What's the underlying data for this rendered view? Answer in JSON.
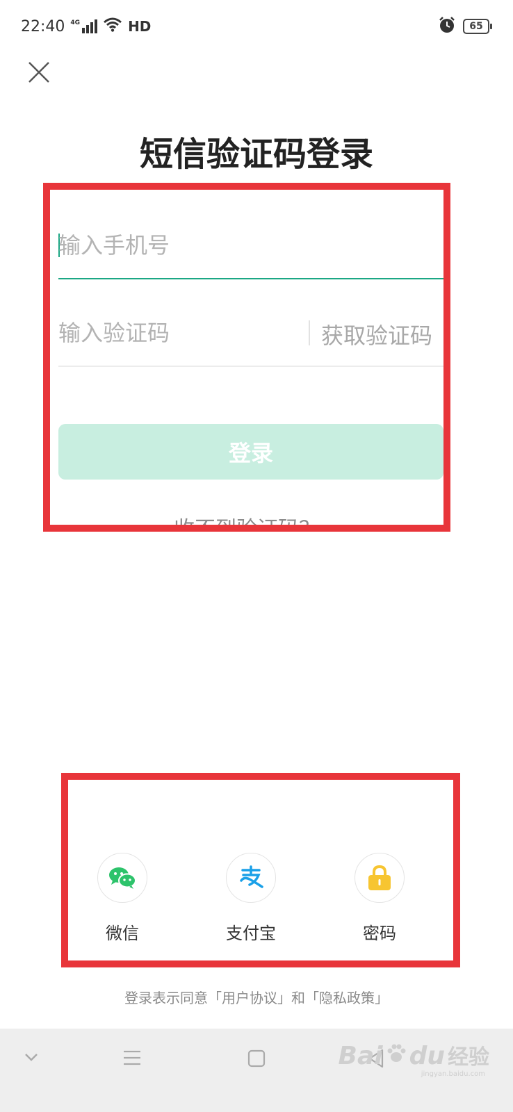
{
  "status_bar": {
    "time": "22:40",
    "network": "4G",
    "hd": "HD",
    "battery": "65",
    "icons": [
      "signal-icon",
      "wifi-icon",
      "alarm-icon",
      "battery-icon"
    ]
  },
  "page": {
    "title": "短信验证码登录",
    "close_icon": "close-icon"
  },
  "form": {
    "phone_placeholder": "输入手机号",
    "code_placeholder": "输入验证码",
    "get_code_label": "获取验证码",
    "login_label": "登录",
    "help_text": "收不到验证码？"
  },
  "third_party": {
    "items": [
      {
        "label": "微信",
        "icon": "wechat-icon"
      },
      {
        "label": "支付宝",
        "icon": "alipay-icon"
      },
      {
        "label": "密码",
        "icon": "lock-icon"
      }
    ]
  },
  "agreement": {
    "text": "登录表示同意「用户协议」和「隐私政策」"
  },
  "nav_bar": {
    "icons": [
      "chevron-down-icon",
      "menu-icon",
      "home-square-icon",
      "back-triangle-icon"
    ]
  },
  "watermark": {
    "brand_latin": "Bai",
    "brand_latin_2": "du",
    "brand_cn": "经验",
    "url": "jingyan.baidu.com"
  },
  "colors": {
    "accent": "#1ba784",
    "button_disabled": "#c8eee0",
    "annotation": "#e8353a",
    "wechat": "#2dc36b",
    "alipay": "#1aa0e8",
    "lock": "#f7c531"
  }
}
